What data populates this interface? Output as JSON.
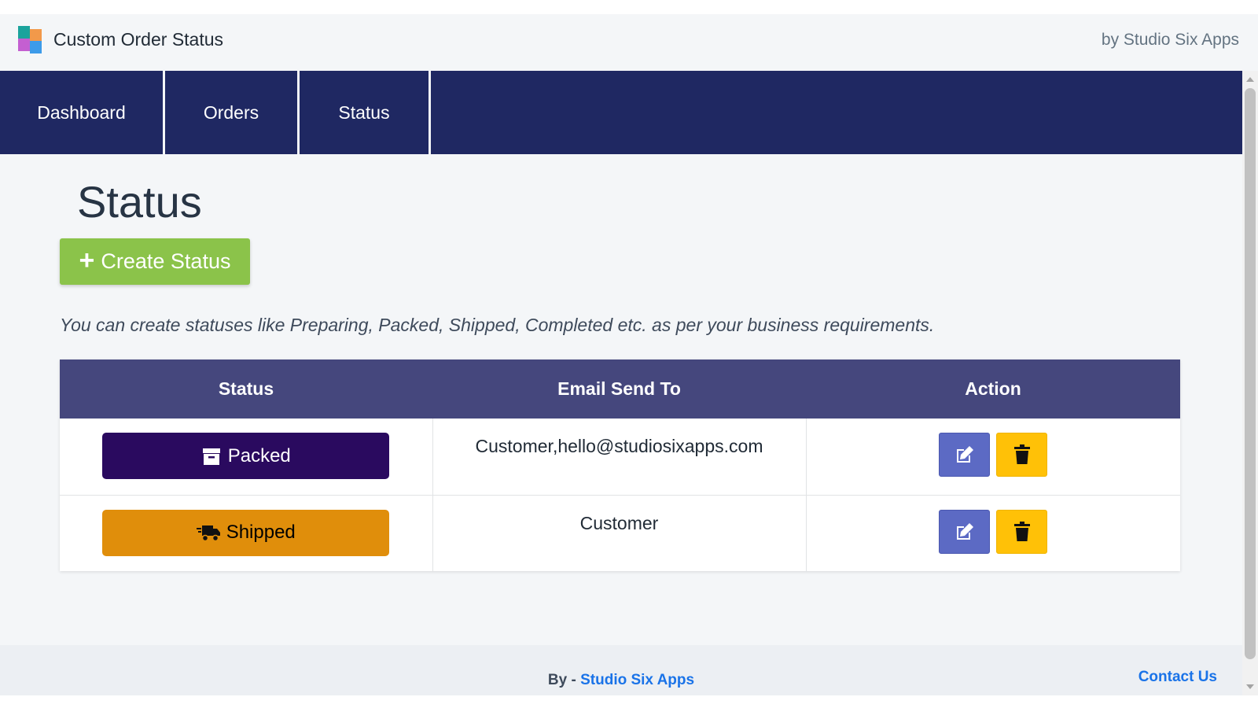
{
  "app": {
    "title": "Custom Order Status",
    "vendor": "by Studio Six Apps"
  },
  "nav": {
    "items": [
      {
        "label": "Dashboard"
      },
      {
        "label": "Orders"
      },
      {
        "label": "Status"
      }
    ]
  },
  "page": {
    "title": "Status",
    "create_button": "Create Status",
    "hint": "You can create statuses like Preparing, Packed, Shipped, Completed etc. as per your business requirements."
  },
  "table": {
    "headers": [
      "Status",
      "Email Send To",
      "Action"
    ],
    "rows": [
      {
        "status": "Packed",
        "email": "Customer,hello@studiosixapps.com",
        "color": "#2a0a5f",
        "text_color": "#ffffff",
        "icon": "archive-icon"
      },
      {
        "status": "Shipped",
        "email": "Customer",
        "color": "#e08e0b",
        "text_color": "#000000",
        "icon": "shipping-fast-icon"
      }
    ]
  },
  "footer": {
    "by_label": "By -",
    "by_link": "Studio Six Apps",
    "contact": "Contact Us"
  },
  "colors": {
    "nav": "#1f2862",
    "table_header": "#45477d",
    "create": "#8bc34a",
    "edit": "#5c6ac4",
    "delete": "#ffc107",
    "link": "#1a73e8"
  }
}
